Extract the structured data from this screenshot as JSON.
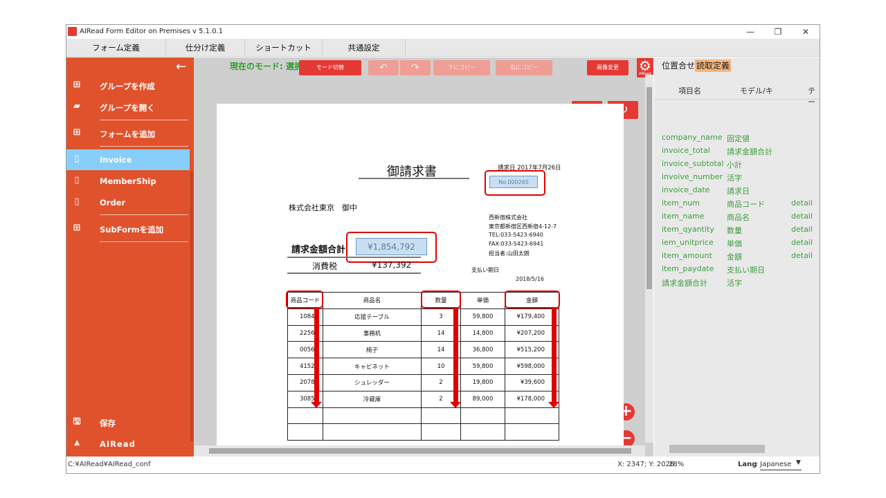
{
  "window": {
    "title": "AIRead Form Editor on Premises v 5.1.0.1",
    "controls": [
      "—",
      "❐",
      "✕"
    ]
  },
  "menu": [
    "フォーム定義",
    "仕分け定義",
    "ショートカット",
    "共通設定"
  ],
  "sidebar": {
    "items": [
      {
        "label": "グループを作成",
        "icon": "plus-square-icon"
      },
      {
        "label": "グループを開く",
        "icon": "folder-open-icon"
      },
      {
        "label": "フォームを追加",
        "icon": "plus-square-icon"
      },
      {
        "label": "Invoice",
        "icon": "document-icon",
        "active": true
      },
      {
        "label": "MemberShip",
        "icon": "document-icon"
      },
      {
        "label": "Order",
        "icon": "document-icon"
      },
      {
        "label": "SubFormを追加",
        "icon": "plus-square-icon"
      }
    ],
    "save_label": "保存",
    "brand_label": "AIRead"
  },
  "toolbar": {
    "mode_label": "現在のモード: 選択",
    "mode_switch": "モード切替",
    "copy_down": "下にコピー",
    "copy_right": "右にコピー",
    "image_change": "画像変更",
    "gear_caption": "AIRead"
  },
  "document": {
    "title": "御請求書",
    "date": "請求日 2017年7月26日",
    "number": "No.000265",
    "recipient": "株式会社東京　御中",
    "sender": [
      "西新宿株式会社",
      "東京都新宿区西新宿4-12-7",
      "TEL:033-5423-6940",
      "FAX:033-5423-6941",
      "担当者:山田太朗"
    ],
    "total_label": "請求金額合計",
    "total_value": "¥1,854,792",
    "tax_label": "消費税",
    "tax_value": "¥137,392",
    "due_label": "支払い期日",
    "due_date": "2018/5/16",
    "table_headers": [
      "商品コード",
      "商品名",
      "数量",
      "単価",
      "金額"
    ],
    "table_rows": [
      [
        "10845",
        "応接テーブル",
        "3",
        "59,800",
        "¥179,400"
      ],
      [
        "22563",
        "事務机",
        "14",
        "14,800",
        "¥207,200"
      ],
      [
        "00562",
        "椅子",
        "14",
        "36,800",
        "¥515,200"
      ],
      [
        "41523",
        "キャビネット",
        "10",
        "59,800",
        "¥598,000"
      ],
      [
        "20783",
        "シュレッダー",
        "2",
        "19,800",
        "¥39,600"
      ],
      [
        "30856",
        "冷蔵庫",
        "2",
        "89,000",
        "¥178,000"
      ],
      [
        "",
        "",
        "",
        "",
        ""
      ],
      [
        "",
        "",
        "",
        "",
        ""
      ]
    ]
  },
  "right_panel": {
    "tabs": [
      "位置合せ",
      "読取定義"
    ],
    "headers": [
      "項目名",
      "モデル/キ",
      "テー"
    ],
    "rows": [
      [
        "company_name",
        "固定値",
        ""
      ],
      [
        "invoice_total",
        "請求金額合計",
        ""
      ],
      [
        "invoice_subtotal",
        "小計",
        ""
      ],
      [
        "invoive_number",
        "活字",
        ""
      ],
      [
        "invoice_date",
        "請求日",
        ""
      ],
      [
        "item_num",
        "商品コード",
        "detail"
      ],
      [
        "item_name",
        "商品名",
        "detail"
      ],
      [
        "item_qyantity",
        "数量",
        "detail"
      ],
      [
        "iem_unitprice",
        "単価",
        "detail"
      ],
      [
        "item_amount",
        "金額",
        "detail"
      ],
      [
        "item_paydate",
        "支払い期日",
        ""
      ],
      [
        "請求金額合計",
        "活字",
        ""
      ]
    ]
  },
  "statusbar": {
    "path": "C:¥AIRead¥AIRead_conf",
    "coords": "X: 2347; Y: 2026",
    "zoom": "28%",
    "lang_label": "Lang",
    "lang_sep": ":",
    "lang_value": "Japanese"
  },
  "colors": {
    "accent": "#e53935",
    "sidebar": "#e0522c",
    "active": "#87cefa",
    "mode_green": "#2e9e2e"
  }
}
